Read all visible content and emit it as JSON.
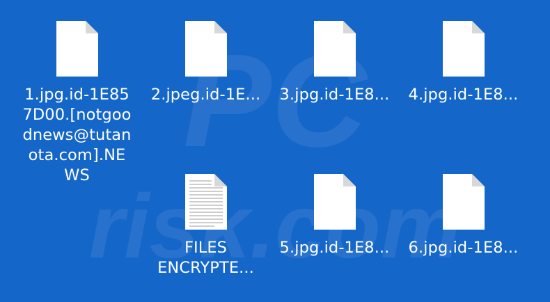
{
  "files": [
    {
      "name_lines": [
        "1.jpg.id-1E85",
        "7D00.[notgoo",
        "dnews@tutan",
        "ota.com].NE",
        "WS"
      ],
      "icon": "blank-document-icon"
    },
    {
      "name": "2.jpeg.id-1E...",
      "icon": "blank-document-icon"
    },
    {
      "name": "3.jpg.id-1E8...",
      "icon": "blank-document-icon"
    },
    {
      "name": "4.jpg.id-1E8...",
      "icon": "blank-document-icon"
    },
    {
      "name_lines": [
        "FILES",
        "ENCRYPTE..."
      ],
      "icon": "text-document-icon"
    },
    {
      "name": "5.jpg.id-1E8...",
      "icon": "blank-document-icon"
    },
    {
      "name": "6.jpg.id-1E8...",
      "icon": "blank-document-icon"
    }
  ],
  "colors": {
    "desktop_background": "#1566c9",
    "label_text": "#ffffff",
    "icon_page": "#ffffff",
    "icon_fold": "#d8d8d8"
  }
}
